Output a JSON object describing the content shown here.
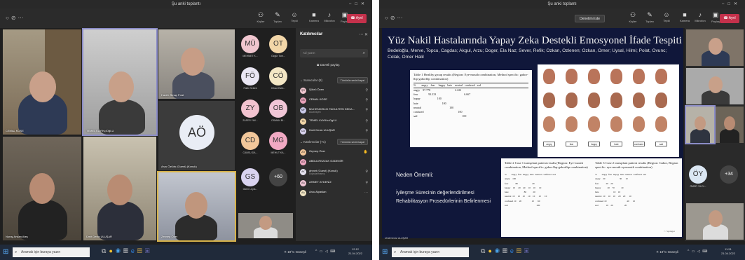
{
  "screen1": {
    "window_title": "Şu anki toplantı",
    "toolbar": {
      "participants": "Kişiler",
      "chat": "Toplan",
      "react": "Tepki",
      "camera": "Kamera",
      "mic": "Mikrofon",
      "share": "Paylaş",
      "leave": "Ayrıl"
    },
    "tiles": [
      {
        "name": "CEMAL KOSE"
      },
      {
        "name": "TEMEL KAYIKçIOğLU"
      },
      {
        "name": "Hanife Sinap Fırat"
      },
      {
        "name": "Arzu Öztürk (Guest) (Konuk)"
      },
      {
        "name": "Nuray Arslan Ateş"
      },
      {
        "name": "Ümit Deniz ULUŞAR"
      },
      {
        "name": "Zeynep Özer"
      }
    ],
    "big_avatar": "AÖ",
    "avatars": [
      {
        "initials": "MÜ",
        "name": "MEHMET K...",
        "color": "#f0c6cf"
      },
      {
        "initials": "OT",
        "name": "Özgür Tom...",
        "color": "#f2d6a8"
      },
      {
        "initials": "FÖ",
        "name": "Fatih Öztürk",
        "color": "#e9e6f3"
      },
      {
        "initials": "CÖ",
        "name": "Cihad Öztü...",
        "color": "#f3e7c5"
      },
      {
        "initials": "ZY",
        "name": "ZAFER YAV...",
        "color": "#f2c3cf"
      },
      {
        "initials": "OB",
        "name": "OSMAN BI...",
        "color": "#f0c6d6"
      },
      {
        "initials": "CD",
        "name": "CANSU DA...",
        "color": "#f2c79a"
      },
      {
        "initials": "MG",
        "name": "MEHUT KA...",
        "color": "#f1a9c3"
      },
      {
        "initials": "GS",
        "name": "Güler Leyla...",
        "color": "#d9d3ef"
      }
    ],
    "more_count": "+60",
    "panel": {
      "title": "Katılımcılar",
      "search_placeholder": "Ad yazın",
      "share_label": "Davetli paylaş",
      "presenters_label": "Sunucular (8)",
      "mute_all_1": "Tümünün sesini kapat",
      "attendees_label": "Katılımcılar (71)",
      "mute_all_2": "Tümünün sesini kapat",
      "presenters": [
        {
          "initials": "ŞÖ",
          "name": "Şükrü Özen",
          "sub": "",
          "color": "#f0c6cf"
        },
        {
          "initials": "CK",
          "name": "CEMAL KOSE",
          "sub": "",
          "color": "#e8a0b8"
        },
        {
          "initials": "MF",
          "name": "MUHENDISLIK FAKULTESI DEKA...",
          "sub": "Düzenleyen",
          "color": "#c8c8e8"
        },
        {
          "initials": "TK",
          "name": "TEMEL KAYIKcıOgLU",
          "sub": "",
          "color": "#f2d6a8"
        },
        {
          "initials": "ÜU",
          "name": "Ümit Deniz ULUŞAR",
          "sub": "",
          "color": "#d9d3ef"
        }
      ],
      "attendees": [
        {
          "initials": "ZÖ",
          "name": "Zeynep Özer",
          "sub": "",
          "color": "#f2c79a"
        },
        {
          "initials": "AÖ",
          "name": "ABDULREZZAK ÖZDEMİR",
          "sub": "",
          "color": "#f1a9c3"
        },
        {
          "initials": "AK",
          "name": "ahmet (Guest) (Konuk)",
          "sub": "Doğrulanmamış",
          "color": "#e9e6f3"
        },
        {
          "initials": "AA",
          "name": "AHMET AYDENİZ",
          "sub": "",
          "color": "#f0c6d6"
        },
        {
          "initials": "AA",
          "name": "Arzu Alpaslan",
          "sub": "",
          "color": "#f3e7c5"
        }
      ]
    },
    "taskbar": {
      "search_placeholder": "Aramak için buraya yazın",
      "weather": "19°C Güneşli",
      "time": "12:12",
      "date": "21.04.2022"
    }
  },
  "screen2": {
    "window_title": "Şu anki toplantı",
    "toolbar": {
      "present_stop": "Denetimi iste",
      "participants": "Kişiler",
      "chat": "Toplan",
      "react": "Tepki",
      "camera": "Kamera",
      "mic": "Mikrofon",
      "share": "Paylaş",
      "leave": "Ayrıl"
    },
    "slide": {
      "title": "Yüz Nakil Hastalarında Yapay Zeka Destekli Emosyonel İfade Tespiti",
      "authors": "Bedeloğlu, Merve, Topcu, Cagdas; Akgul, Arzu; Doger, Ela Naz; Sever, Refik; Ozkan, Ozlenen; Ozkan, Omer; Uysal, Hilmi; Polat, Ovunc; Colak, Omer Halil",
      "neden": "Neden Önemli:",
      "bullet_1": "İyileşme Sürecinin değerlendirilmesi",
      "bullet_2": "Rehabilitasyon Prosedürlerinin Belirlenmesi",
      "table1_caption": "Table 1   Healthy group results (Region: Eye-mouth combination, Method specific: gabor-lbp-gaborlbp combination)",
      "table1_header": "%        angry    fear     happy   hate    neutral   confused   sad",
      "table1_rows": "angry    97.778                                   2.222\nfear               93.333                                        6.667\nhappy                        100\nhate                                  100\nneutral                                        100\nconfused                                                 100\nsad                                                                100",
      "table2_caption": "Table 2   Case 1 transplant patient results (Region: Eye-mouth combination, Method specific: gabor-lbp-gaborlbp combination)",
      "table2_rows": "%        angry  fear  happy  hate  neutral  confused  sad\nangry    100\nfear            80                        20\nhappy    10     20    40     10    10      10\nhate                          80           20\nneutral  10     10    10     10    10      10      10\nconfused 10     20                 10      60\nsad                                                100",
      "table3_caption": "Table 3   Case 2 transplant patient results (Region: Gabor, Region specific: eye-mouth-eyemouth combination)",
      "table3_rows": "%        angry  fear  happy  hate  neutral  confused  sad\nangry    20                        30      10\nfear            20    20\nhappy           20    70           10\nhate                        10    10\nneutral  10     10    10     20    20      10\nconfused 10                                  40      10\nsad             10    20                   20",
      "face_labels": [
        "angry",
        "fear",
        "happy",
        "hate",
        "confused",
        "sad"
      ],
      "springer": "Springer"
    },
    "side_tiles": [
      {
        "name": ""
      },
      {
        "name": ""
      },
      {
        "name": ""
      },
      {
        "name": ""
      }
    ],
    "avatar_oy": "ÖY",
    "avatar_oy_name": "ÖMER YILDI...",
    "more_count": "+34",
    "bottom_tile_name": "Ümit Deniz ULUŞAR",
    "taskbar": {
      "search_placeholder": "Aramak için buraya yazın",
      "weather": "19°C Güneşli",
      "time": "11:51",
      "date": "21.04.2022"
    }
  }
}
